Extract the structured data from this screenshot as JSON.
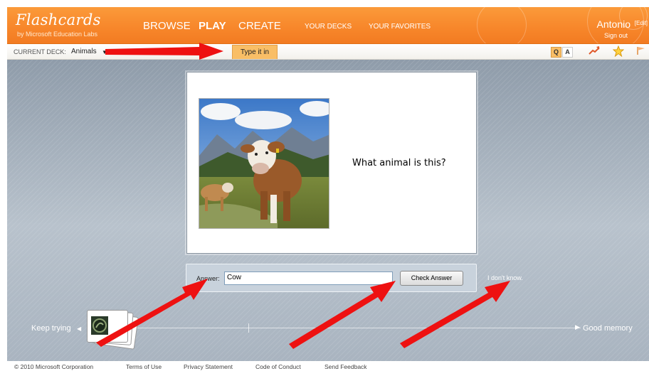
{
  "header": {
    "logo_title": "Flashcards",
    "logo_subtitle": "by Microsoft Education Labs",
    "nav": [
      "BROWSE",
      "PLAY",
      "CREATE"
    ],
    "subnav": [
      "YOUR DECKS",
      "YOUR FAVORITES"
    ],
    "user_name": "Antonio",
    "edit_label": "[Edit]",
    "sign_out": "Sign out"
  },
  "toolbar": {
    "deck_label": "CURRENT DECK:",
    "deck_value": "Animals",
    "mode_tab": "Type it in",
    "qa_q": "Q",
    "qa_a": "A",
    "icons": [
      "trend-icon",
      "star-icon",
      "flag-icon"
    ]
  },
  "card": {
    "question": "What animal is this?",
    "image_subject": "cow-photo"
  },
  "answer": {
    "label": "Answer:",
    "value": "Cow",
    "check_button": "Check Answer",
    "dont_know": "I don't know."
  },
  "progress": {
    "left_label": "Keep trying",
    "right_label": "Good memory"
  },
  "footer": {
    "links": [
      "© 2010 Microsoft Corporation",
      "Terms of Use",
      "Privacy Statement",
      "Code of Conduct",
      "Send Feedback"
    ]
  },
  "colors": {
    "header_orange": "#f7862a",
    "tab_highlight": "#f9be66",
    "annotation_red": "#ee1111"
  }
}
